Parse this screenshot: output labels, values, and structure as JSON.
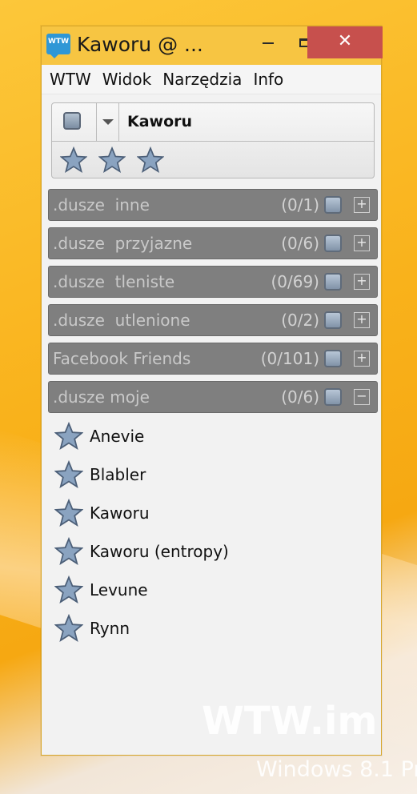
{
  "window": {
    "title": "Kaworu @ ...",
    "icon_label": "WTW",
    "min_icon": "minimize-icon",
    "max_icon": "maximize-icon",
    "close_label": "✕"
  },
  "menu": [
    "WTW",
    "Widok",
    "Narzędzia",
    "Info"
  ],
  "profile": {
    "name": "Kaworu",
    "stars": 3
  },
  "groups": [
    {
      "name": ".dusze  inne",
      "count": "(0/1)",
      "toggle": "+"
    },
    {
      "name": ".dusze  przyjazne",
      "count": "(0/6)",
      "toggle": "+"
    },
    {
      "name": ".dusze  tleniste",
      "count": "(0/69)",
      "toggle": "+"
    },
    {
      "name": ".dusze  utlenione",
      "count": "(0/2)",
      "toggle": "+"
    },
    {
      "name": "Facebook Friends",
      "count": "(0/101)",
      "toggle": "+"
    },
    {
      "name": ".dusze moje",
      "count": "(0/6)",
      "toggle": "−"
    }
  ],
  "contacts": [
    "Anevie",
    "Blabler",
    "Kaworu",
    "Kaworu (entropy)",
    "Levune",
    "Rynn"
  ],
  "watermark": "WTW.im",
  "desktop_watermark": "Windows 8.1 Pr",
  "colors": {
    "titlebar": "#f7c542",
    "close": "#c7504d",
    "group_bg": "#7f7f7f",
    "star_fill": "#8aa3c0"
  }
}
